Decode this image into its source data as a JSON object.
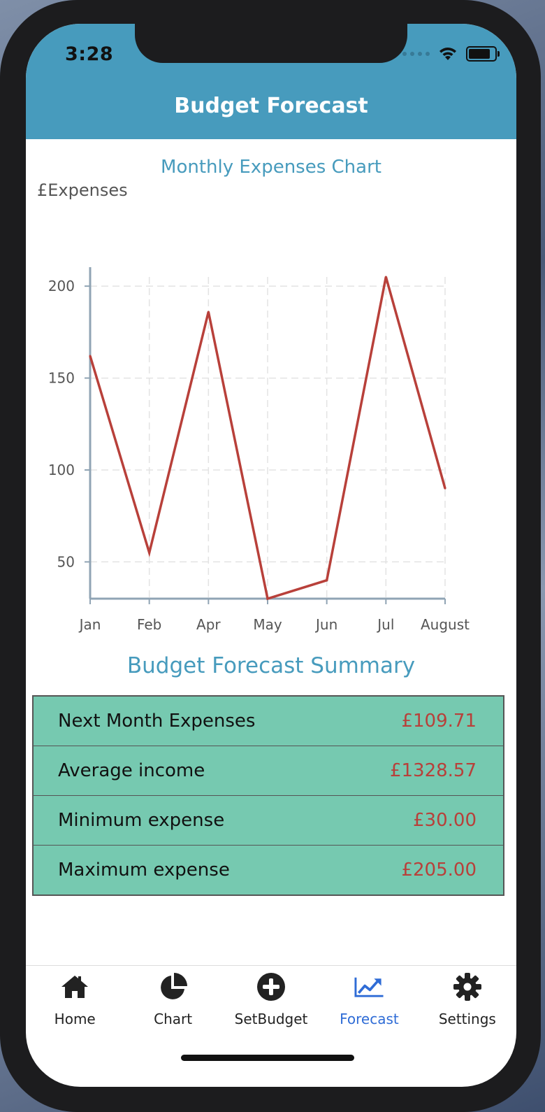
{
  "status_bar": {
    "time": "3:28"
  },
  "header": {
    "title": "Budget Forecast"
  },
  "chart_data": {
    "type": "line",
    "title": "Monthly Expenses Chart",
    "ylabel": "£Expenses",
    "xlabel": "",
    "categories": [
      "Jan",
      "Feb",
      "Apr",
      "May",
      "Jun",
      "Jul",
      "August"
    ],
    "values": [
      162,
      55,
      186,
      30,
      40,
      205,
      90
    ],
    "ylim": [
      30,
      205
    ],
    "yticks": [
      50,
      100,
      150,
      200
    ],
    "grid": true,
    "line_color": "#b8403a"
  },
  "summary": {
    "title": "Budget Forecast Summary",
    "rows": [
      {
        "label": "Next Month Expenses",
        "value": "£109.71"
      },
      {
        "label": "Average income",
        "value": "£1328.57"
      },
      {
        "label": "Minimum expense",
        "value": "£30.00"
      },
      {
        "label": "Maximum expense",
        "value": "£205.00"
      }
    ]
  },
  "tabs": [
    {
      "label": "Home",
      "icon": "home-icon",
      "active": false
    },
    {
      "label": "Chart",
      "icon": "pie-chart-icon",
      "active": false
    },
    {
      "label": "SetBudget",
      "icon": "plus-circle-icon",
      "active": false
    },
    {
      "label": "Forecast",
      "icon": "trending-up-icon",
      "active": true
    },
    {
      "label": "Settings",
      "icon": "gear-icon",
      "active": false
    }
  ],
  "colors": {
    "header_bg": "#479bbd",
    "accent": "#479bbd",
    "table_bg": "#76c9b0",
    "value_text": "#b8403a",
    "active_tab": "#2f6cd6"
  }
}
